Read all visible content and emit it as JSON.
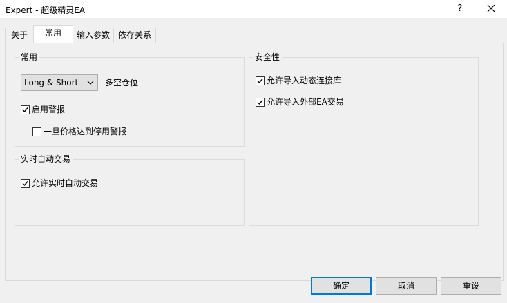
{
  "window": {
    "title": "Expert - 超级精灵EA",
    "help_label": "?"
  },
  "tabs": [
    {
      "label": "关于"
    },
    {
      "label": "常用"
    },
    {
      "label": "输入参数"
    },
    {
      "label": "依存关系"
    }
  ],
  "common_group": {
    "title": "常用",
    "position_select": {
      "value": "Long & Short"
    },
    "position_label": "多空仓位",
    "enable_alerts": {
      "label": "启用警报",
      "checked": true
    },
    "disable_alert_on_stop": {
      "label": "一旦价格达到停用警报",
      "checked": false
    }
  },
  "live_trading_group": {
    "title": "实时自动交易",
    "allow_live_trading": {
      "label": "允许实时自动交易",
      "checked": true
    }
  },
  "safety_group": {
    "title": "安全性",
    "allow_dll_imports": {
      "label": "允许导入动态连接库",
      "checked": true
    },
    "allow_external_ea": {
      "label": "允许导入外部EA交易",
      "checked": true
    }
  },
  "buttons": {
    "ok": "确定",
    "cancel": "取消",
    "reset": "重设"
  }
}
